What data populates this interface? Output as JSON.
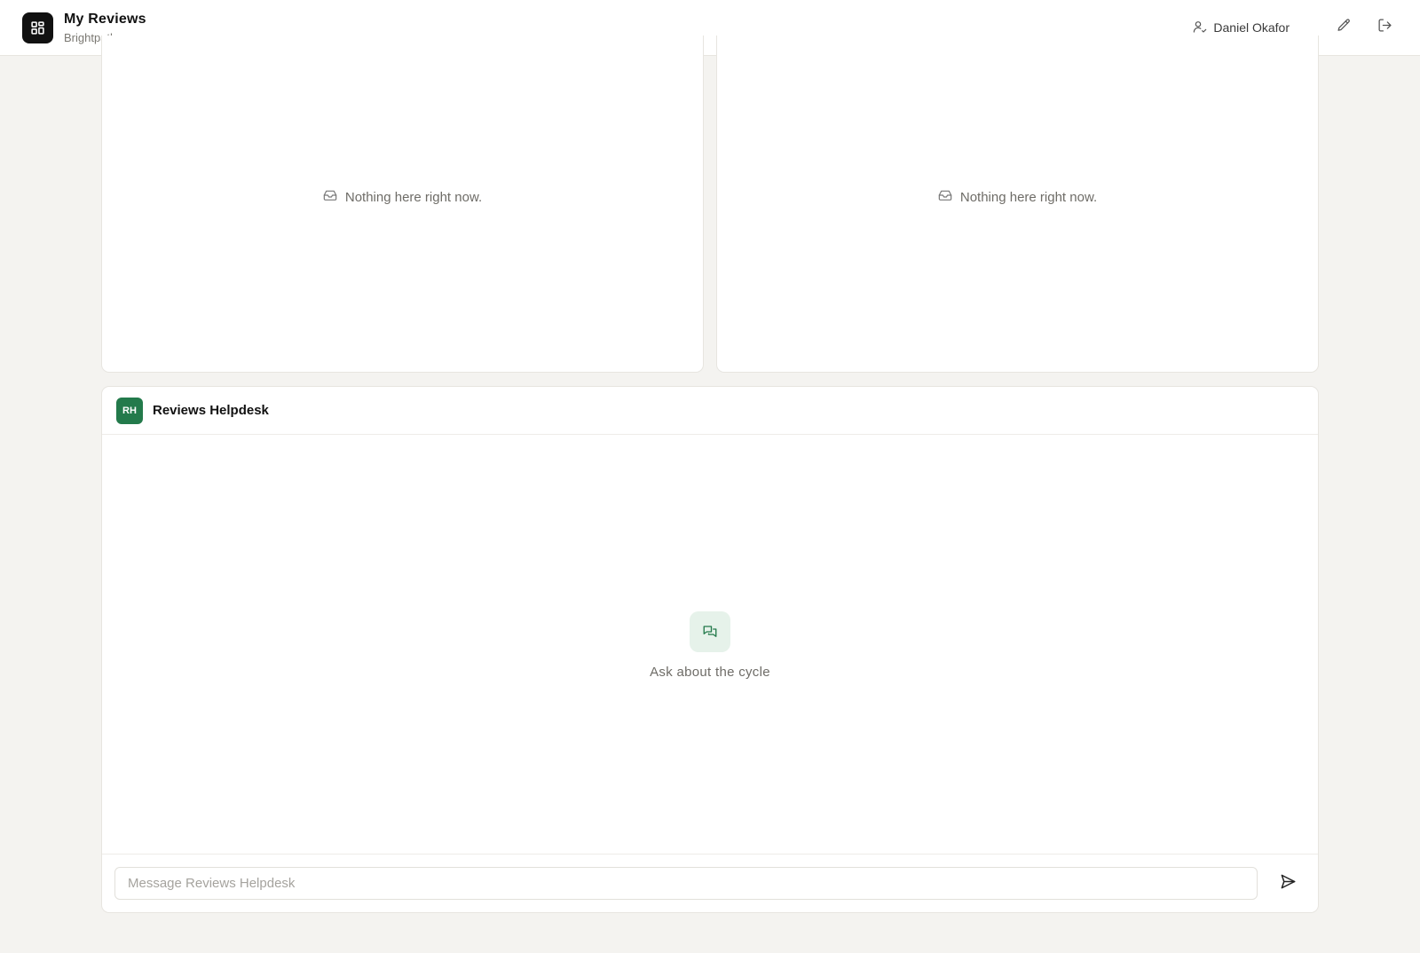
{
  "header": {
    "app_title": "My Reviews",
    "app_subtitle": "Brightpath",
    "logo_icon": "grid-icon",
    "user_name": "Daniel Okafor",
    "user_icon": "user-check-icon",
    "edit_icon": "pencil-icon",
    "logout_icon": "logout-icon"
  },
  "panels": [
    {
      "empty_text": "Nothing here right now.",
      "icon": "inbox-icon"
    },
    {
      "empty_text": "Nothing here right now.",
      "icon": "inbox-icon"
    }
  ],
  "helpdesk": {
    "avatar_initials": "RH",
    "title": "Reviews Helpdesk",
    "empty_prompt": "Ask about the cycle",
    "empty_icon": "chat-bubbles-icon",
    "input_placeholder": "Message Reviews Helpdesk",
    "input_value": "",
    "send_icon": "send-icon"
  },
  "colors": {
    "accent": "#237a4b",
    "accent_soft": "#e6f2ea",
    "background": "#f4f3f0"
  }
}
